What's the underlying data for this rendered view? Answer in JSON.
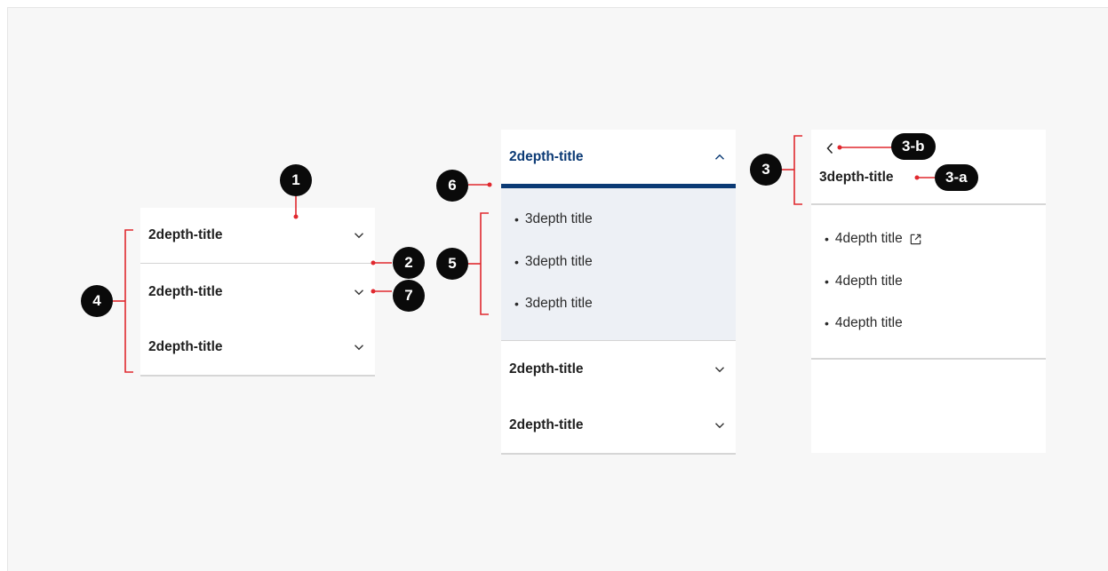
{
  "colors": {
    "accent_navy": "#0b3a75",
    "marker_red": "#e0282e",
    "expanded_bg": "#edf0f5"
  },
  "panel_a": {
    "items": [
      {
        "label": "2depth-title"
      },
      {
        "label": "2depth-title"
      },
      {
        "label": "2depth-title"
      }
    ]
  },
  "panel_b": {
    "active_title": "2depth-title",
    "sub_items": [
      {
        "label": "3depth title"
      },
      {
        "label": "3depth title"
      },
      {
        "label": "3depth title"
      }
    ],
    "items": [
      {
        "label": "2depth-title"
      },
      {
        "label": "2depth-title"
      }
    ]
  },
  "panel_c": {
    "back_icon": "chevron-left-icon",
    "title": "3depth-title",
    "sub_items": [
      {
        "label": "4depth title",
        "icon": "external-link-icon"
      },
      {
        "label": "4depth title"
      },
      {
        "label": "4depth title"
      }
    ]
  },
  "bullet": "•",
  "badges": {
    "b1": "1",
    "b2": "2",
    "b3": "3",
    "b3a": "3-a",
    "b3b": "3-b",
    "b4": "4",
    "b5": "5",
    "b6": "6",
    "b7": "7"
  }
}
